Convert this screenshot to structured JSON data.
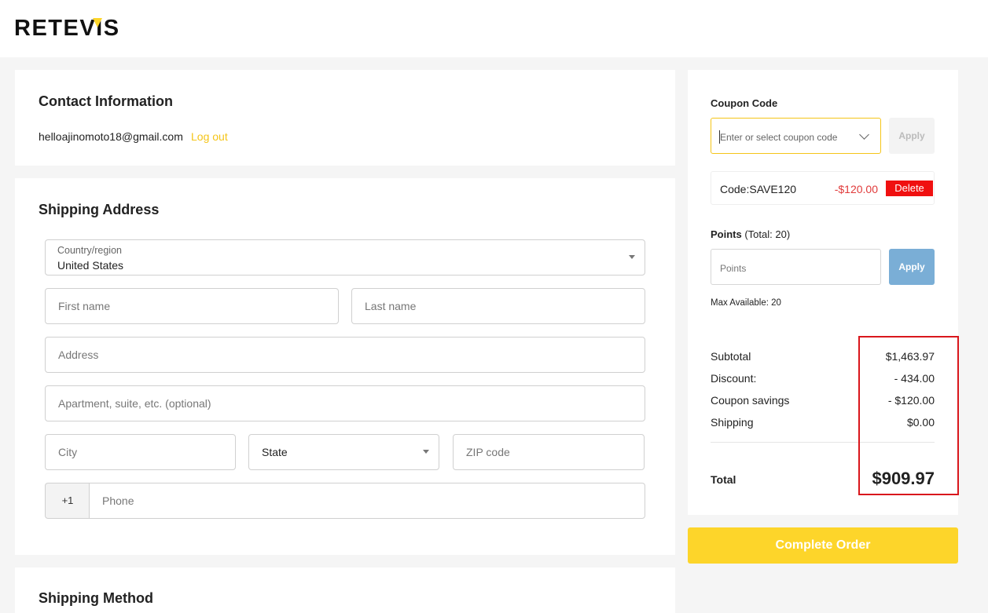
{
  "brand": {
    "logo_text": "RETEVIS"
  },
  "contact": {
    "title": "Contact Information",
    "email": "helloajinomoto18@gmail.com",
    "logout_label": "Log out"
  },
  "shipping": {
    "title": "Shipping Address",
    "country_label": "Country/region",
    "country_value": "United States",
    "first_name_placeholder": "First name",
    "last_name_placeholder": "Last name",
    "address_placeholder": "Address",
    "apartment_placeholder": "Apartment, suite, etc. (optional)",
    "city_placeholder": "City",
    "state_value": "State",
    "zip_placeholder": "ZIP code",
    "phone_prefix": "+1",
    "phone_placeholder": "Phone"
  },
  "shipping_method": {
    "title": "Shipping Method"
  },
  "coupon": {
    "title": "Coupon Code",
    "placeholder": "Enter or select coupon code",
    "apply_label": "Apply",
    "applied_code": "Code:SAVE120",
    "applied_amount": "-$120.00",
    "delete_label": "Delete"
  },
  "points": {
    "title": "Points",
    "total_note": " (Total: 20)",
    "placeholder": "Points",
    "apply_label": "Apply",
    "max_available": "Max Available: 20"
  },
  "totals": {
    "subtotal_label": "Subtotal",
    "subtotal_value": "$1,463.97",
    "discount_label": "Discount:",
    "discount_value": "- 434.00",
    "coupon_label": "Coupon savings",
    "coupon_value": "- $120.00",
    "shipping_label": "Shipping",
    "shipping_value": "$0.00",
    "total_label": "Total",
    "total_value": "$909.97"
  },
  "actions": {
    "complete_order_label": "Complete Order"
  },
  "colors": {
    "accent": "#fdd52a",
    "link": "#f5c518",
    "danger": "#f01010",
    "points_apply": "#7aaed6",
    "highlight": "#d9161c"
  }
}
